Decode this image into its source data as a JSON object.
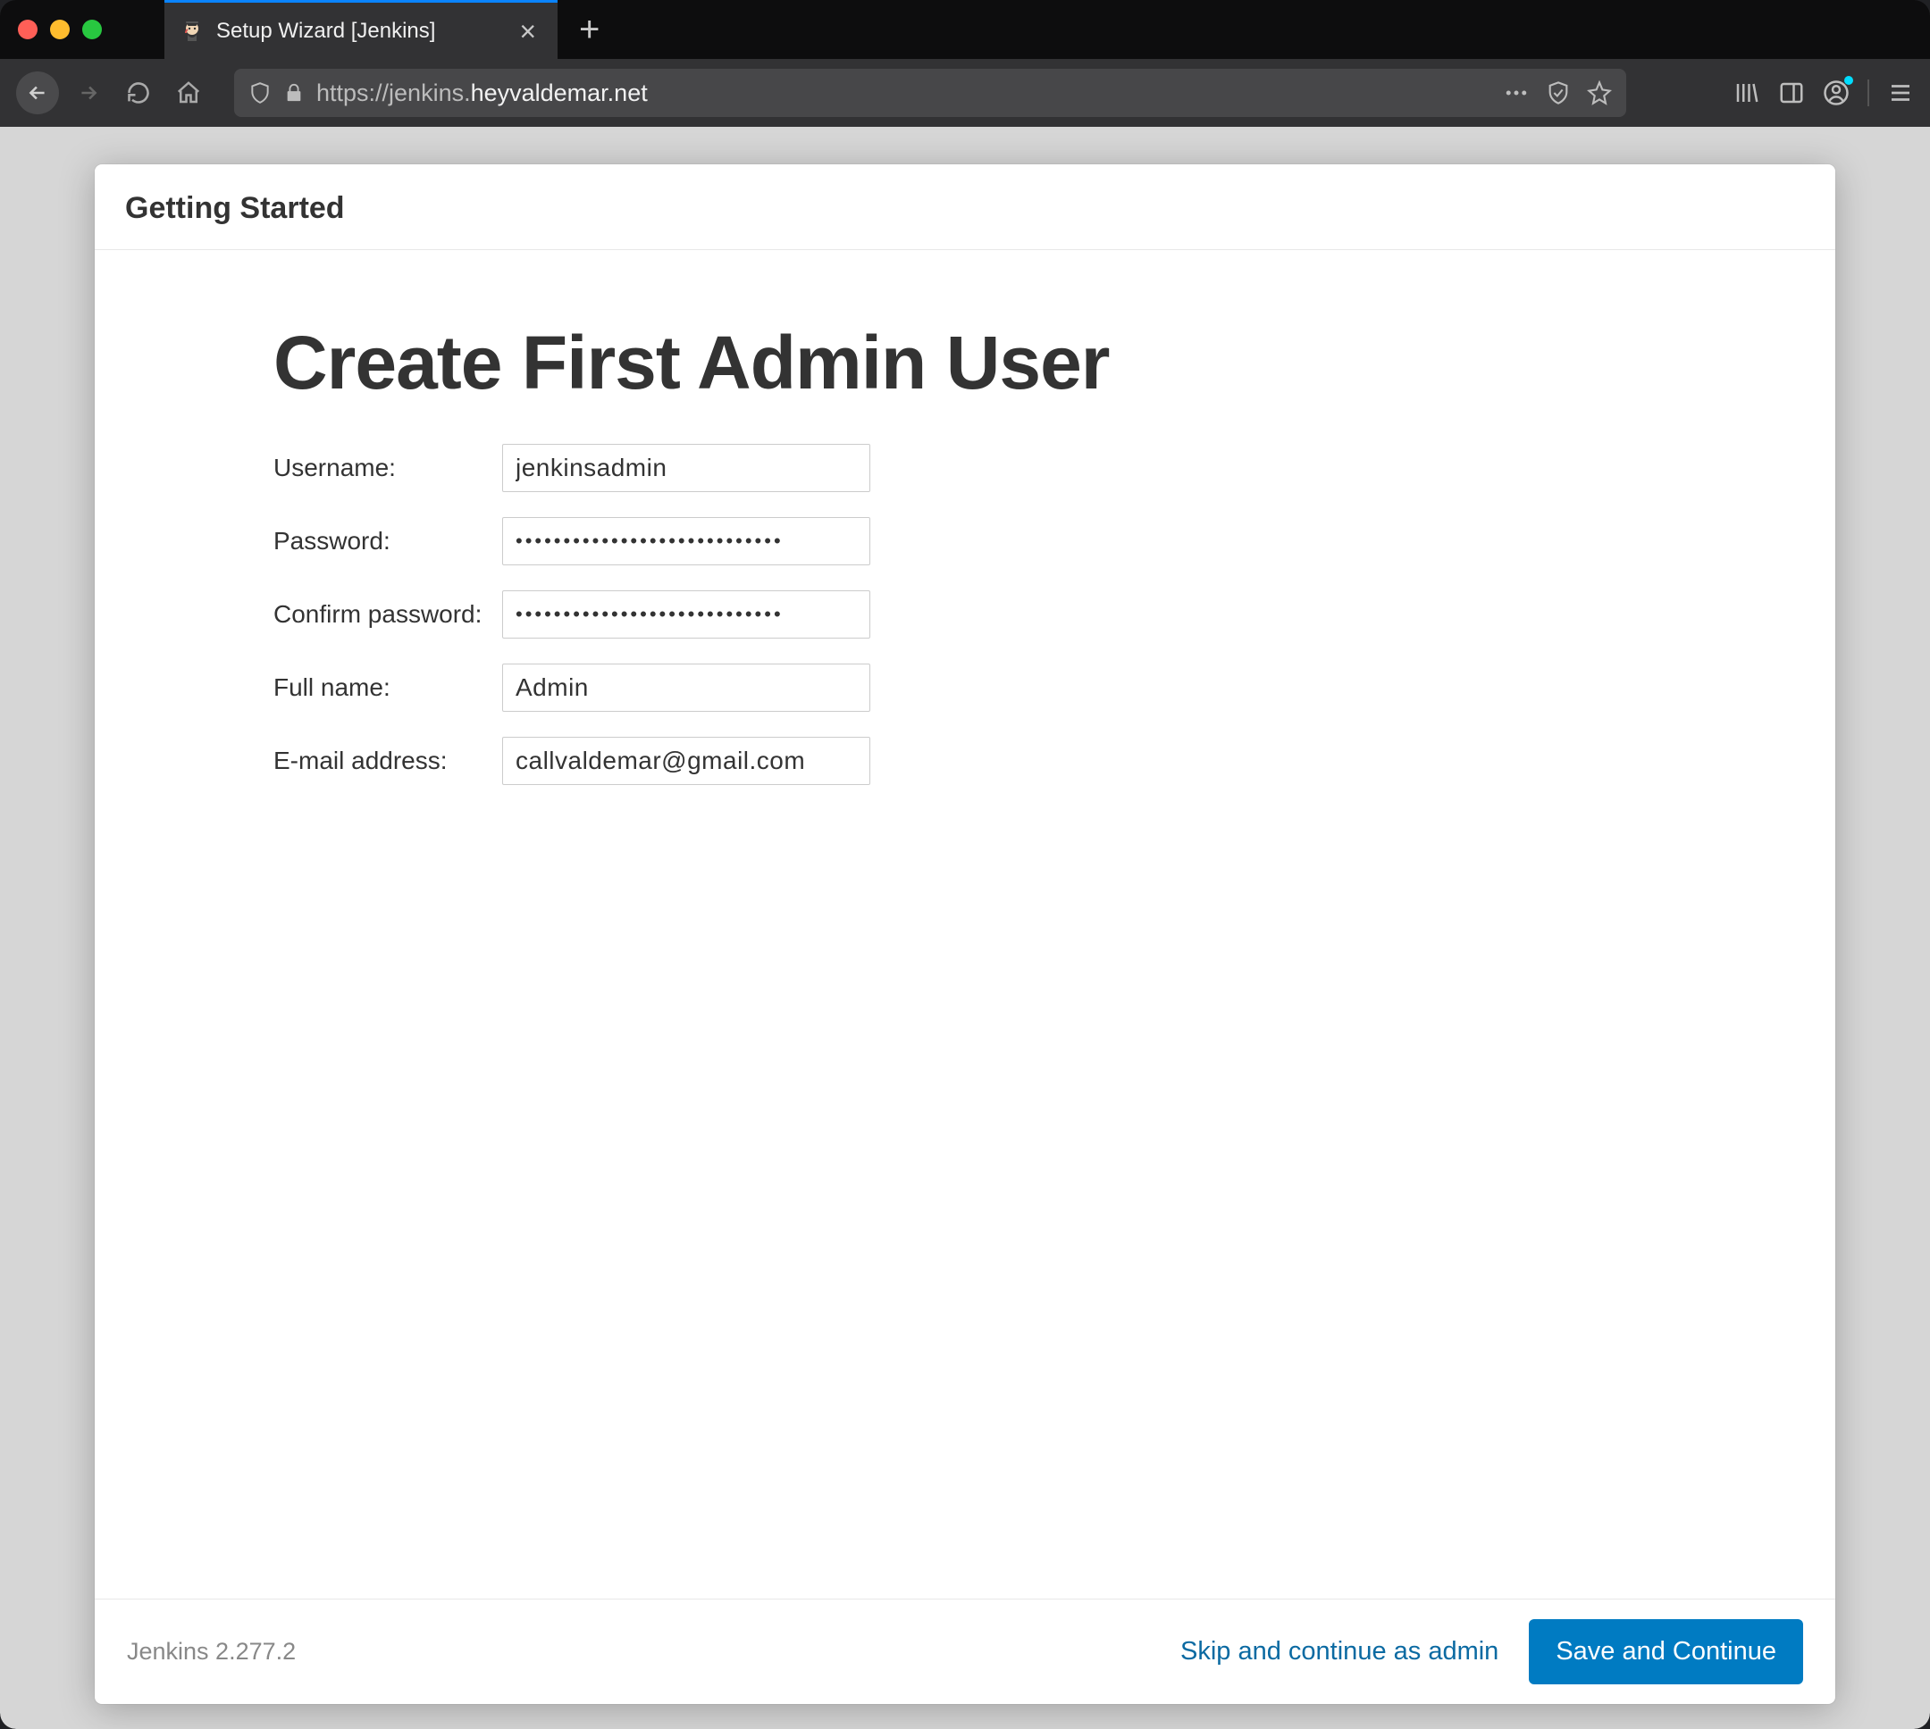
{
  "browser": {
    "tab_title": "Setup Wizard [Jenkins]",
    "url_prefix": "https://jenkins.",
    "url_host": "heyvaldemar.net",
    "url_suffix": ""
  },
  "wizard": {
    "header": "Getting Started",
    "title": "Create First Admin User",
    "labels": {
      "username": "Username:",
      "password": "Password:",
      "confirm": "Confirm password:",
      "fullname": "Full name:",
      "email": "E-mail address:"
    },
    "values": {
      "username": "jenkinsadmin",
      "password": "••••••••••••••••••••••••••••",
      "confirm": "••••••••••••••••••••••••••••",
      "fullname": "Admin",
      "email": "callvaldemar@gmail.com"
    },
    "footer": {
      "version": "Jenkins 2.277.2",
      "skip": "Skip and continue as admin",
      "save": "Save and Continue"
    }
  }
}
